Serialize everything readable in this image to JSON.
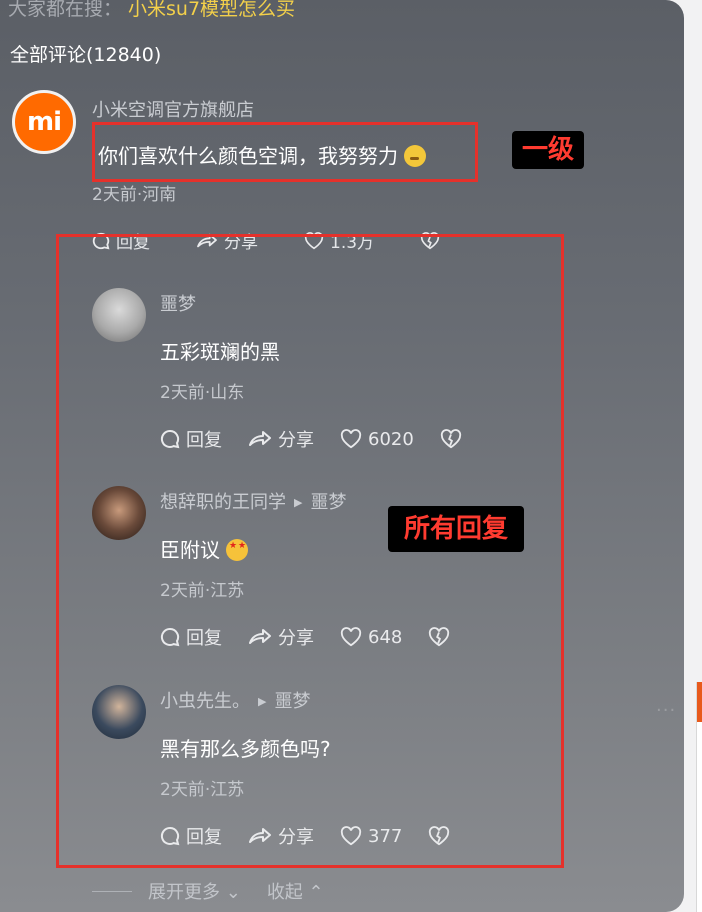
{
  "search": {
    "prefix": "大家都在搜：",
    "keyword": "小米su7模型怎么买"
  },
  "comments_header": {
    "total": "全部评论(12840)"
  },
  "main_comment": {
    "avatar_text": "mi",
    "author": "小米空调官方旗舰店",
    "text": "你们喜欢什么颜色空调，我努努力",
    "meta": "2天前·河南",
    "reply_label": "回复",
    "share_label": "分享",
    "likes": "1.3万"
  },
  "annotations": {
    "level1": "一级",
    "all_replies": "所有回复"
  },
  "replies": [
    {
      "author": "噩梦",
      "reply_to": "",
      "text": "五彩斑斓的黑",
      "meta": "2天前·山东",
      "reply_label": "回复",
      "share_label": "分享",
      "likes": "6020"
    },
    {
      "author": "想辞职的王同学",
      "reply_to": "噩梦",
      "text": "臣附议",
      "meta": "2天前·江苏",
      "reply_label": "回复",
      "share_label": "分享",
      "likes": "648"
    },
    {
      "author": "小虫先生。",
      "reply_to": "噩梦",
      "text": "黑有那么多颜色吗?",
      "meta": "2天前·江苏",
      "reply_label": "回复",
      "share_label": "分享",
      "likes": "377"
    }
  ],
  "footer": {
    "expand": "展开更多",
    "collapse": "收起"
  },
  "colors": {
    "highlight": "#e5312b",
    "brand": "#ff6a00",
    "keyword": "#f3d04a"
  }
}
